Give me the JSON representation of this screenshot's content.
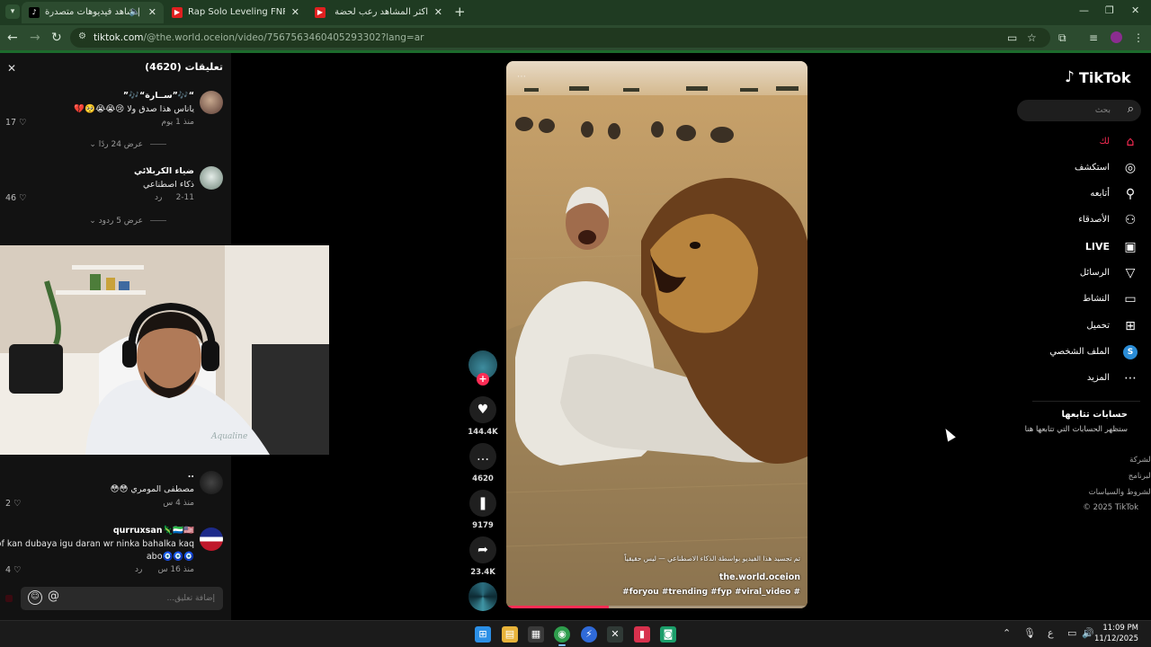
{
  "browser": {
    "tabs": [
      {
        "label": "شاهد فيديوهات متصدرة | ok",
        "active": true,
        "favicon": "tiktok",
        "audio": true
      },
      {
        "label": "Rap Solo Leveling FNR | لمشاهدة الجديد",
        "active": false,
        "favicon": "youtube"
      },
      {
        "label": "اكثر المشاهد رعب لحضة اكل العه",
        "active": false,
        "favicon": "youtube"
      }
    ],
    "url_host": "tiktok.com",
    "url_path": "/@the.world.oceion/video/7567563460405293302?lang=ar"
  },
  "comments_panel": {
    "title": "تعليقات (4620)",
    "reply_label": "رد",
    "input_placeholder": "إضافة تعليق...",
    "items": [
      {
        "name": "“🎶”سـ‍ـارة“🎶”",
        "text": "ياناس هذا صدق ولا 😢😭😭🥺💔",
        "time": "منذ 1 يوم",
        "likes": "17",
        "more": "عرض 24 ردًا"
      },
      {
        "name": "ضياء الكربلائي",
        "text": "ذكاء اصطناعي",
        "time": "2-11",
        "likes": "46",
        "more": "عرض 5 ردود"
      },
      {
        "name": "..",
        "text": "مصطفى المومري 😳😳",
        "time": "منذ 4 س",
        "likes": "2"
      },
      {
        "name": "qurruxsan🦎🇸🇱🇺🇸",
        "text": "qof kan dubaya igu daran wr ninka bahalka kaq",
        "text2": "abo🧿🧿🧿",
        "time": "منذ 16 س",
        "likes": "4"
      }
    ]
  },
  "video": {
    "caption": "تم تجسيد هذا الفيديو بواسطة الذكاء الاصطناعي — ليس حقيقياً",
    "username": "the.world.oceion",
    "hashtags": "#foryou #trending #fyp #viral_video #",
    "progress": 0.34
  },
  "actions": {
    "likes": "144.4K",
    "comments": "4620",
    "saves": "9179",
    "shares": "23.4K"
  },
  "sidebar": {
    "brand": "TikTok",
    "search_placeholder": "بحث",
    "nav": [
      {
        "label": "لك",
        "icon": "home-icon",
        "active": true
      },
      {
        "label": "استكشف",
        "icon": "compass-icon"
      },
      {
        "label": "أتابعه",
        "icon": "user-follow-icon"
      },
      {
        "label": "الأصدقاء",
        "icon": "friends-icon"
      },
      {
        "label": "LIVE",
        "icon": "live-icon"
      },
      {
        "label": "الرسائل",
        "icon": "send-icon"
      },
      {
        "label": "النشاط",
        "icon": "activity-icon"
      },
      {
        "label": "تحميل",
        "icon": "upload-icon"
      },
      {
        "label": "الملف الشخصي",
        "icon": "profile-icon"
      },
      {
        "label": "المزيد",
        "icon": "more-icon"
      }
    ],
    "profile_initial": "S",
    "following_title": "حسابات تتابعها",
    "following_sub": "ستظهر الحسابات التي تتابعها هنا",
    "footer": [
      "الشركة",
      "البرنامج",
      "الشروط والسياسات",
      "© 2025 TikTok"
    ]
  },
  "taskbar": {
    "time": "11:09 PM",
    "date": "11/12/2025",
    "lang": "ع"
  },
  "colors": {
    "accent": "#fe2c55",
    "browser_frame": "#2c4b2f"
  }
}
